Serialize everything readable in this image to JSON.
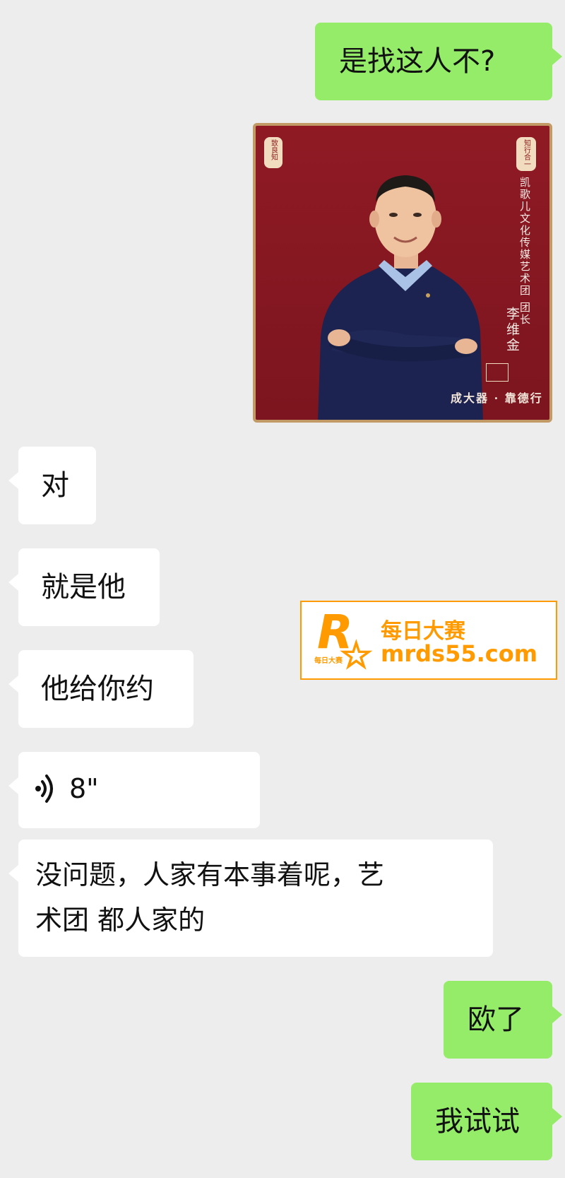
{
  "messages": {
    "m1": {
      "text": "是找这人不?"
    },
    "m2": {
      "seal_left": "致良知",
      "seal_right": "知行合一",
      "title": "凯歌儿文化传媒艺术团 团长",
      "name": "李维金",
      "motto": "成大器 · 靠德行"
    },
    "m3": {
      "text": "对"
    },
    "m4": {
      "text": "就是他"
    },
    "m5": {
      "text": "他给你约"
    },
    "m6": {
      "duration": "8\""
    },
    "m7": {
      "text": "没问题，人家有本事着呢，艺\n术团 都人家的"
    },
    "m8": {
      "text": "欧了"
    },
    "m9": {
      "text": "我试试"
    }
  },
  "watermark": {
    "logo_letter": "R",
    "logo_tiny": "每日大赛",
    "brand": "每日大赛",
    "url": "mrds55.com"
  },
  "colors": {
    "sent_bubble": "#95ec69",
    "recv_bubble": "#ffffff",
    "background": "#ededed",
    "watermark_orange": "#ff9b00",
    "card_red": "#8f1a24"
  }
}
